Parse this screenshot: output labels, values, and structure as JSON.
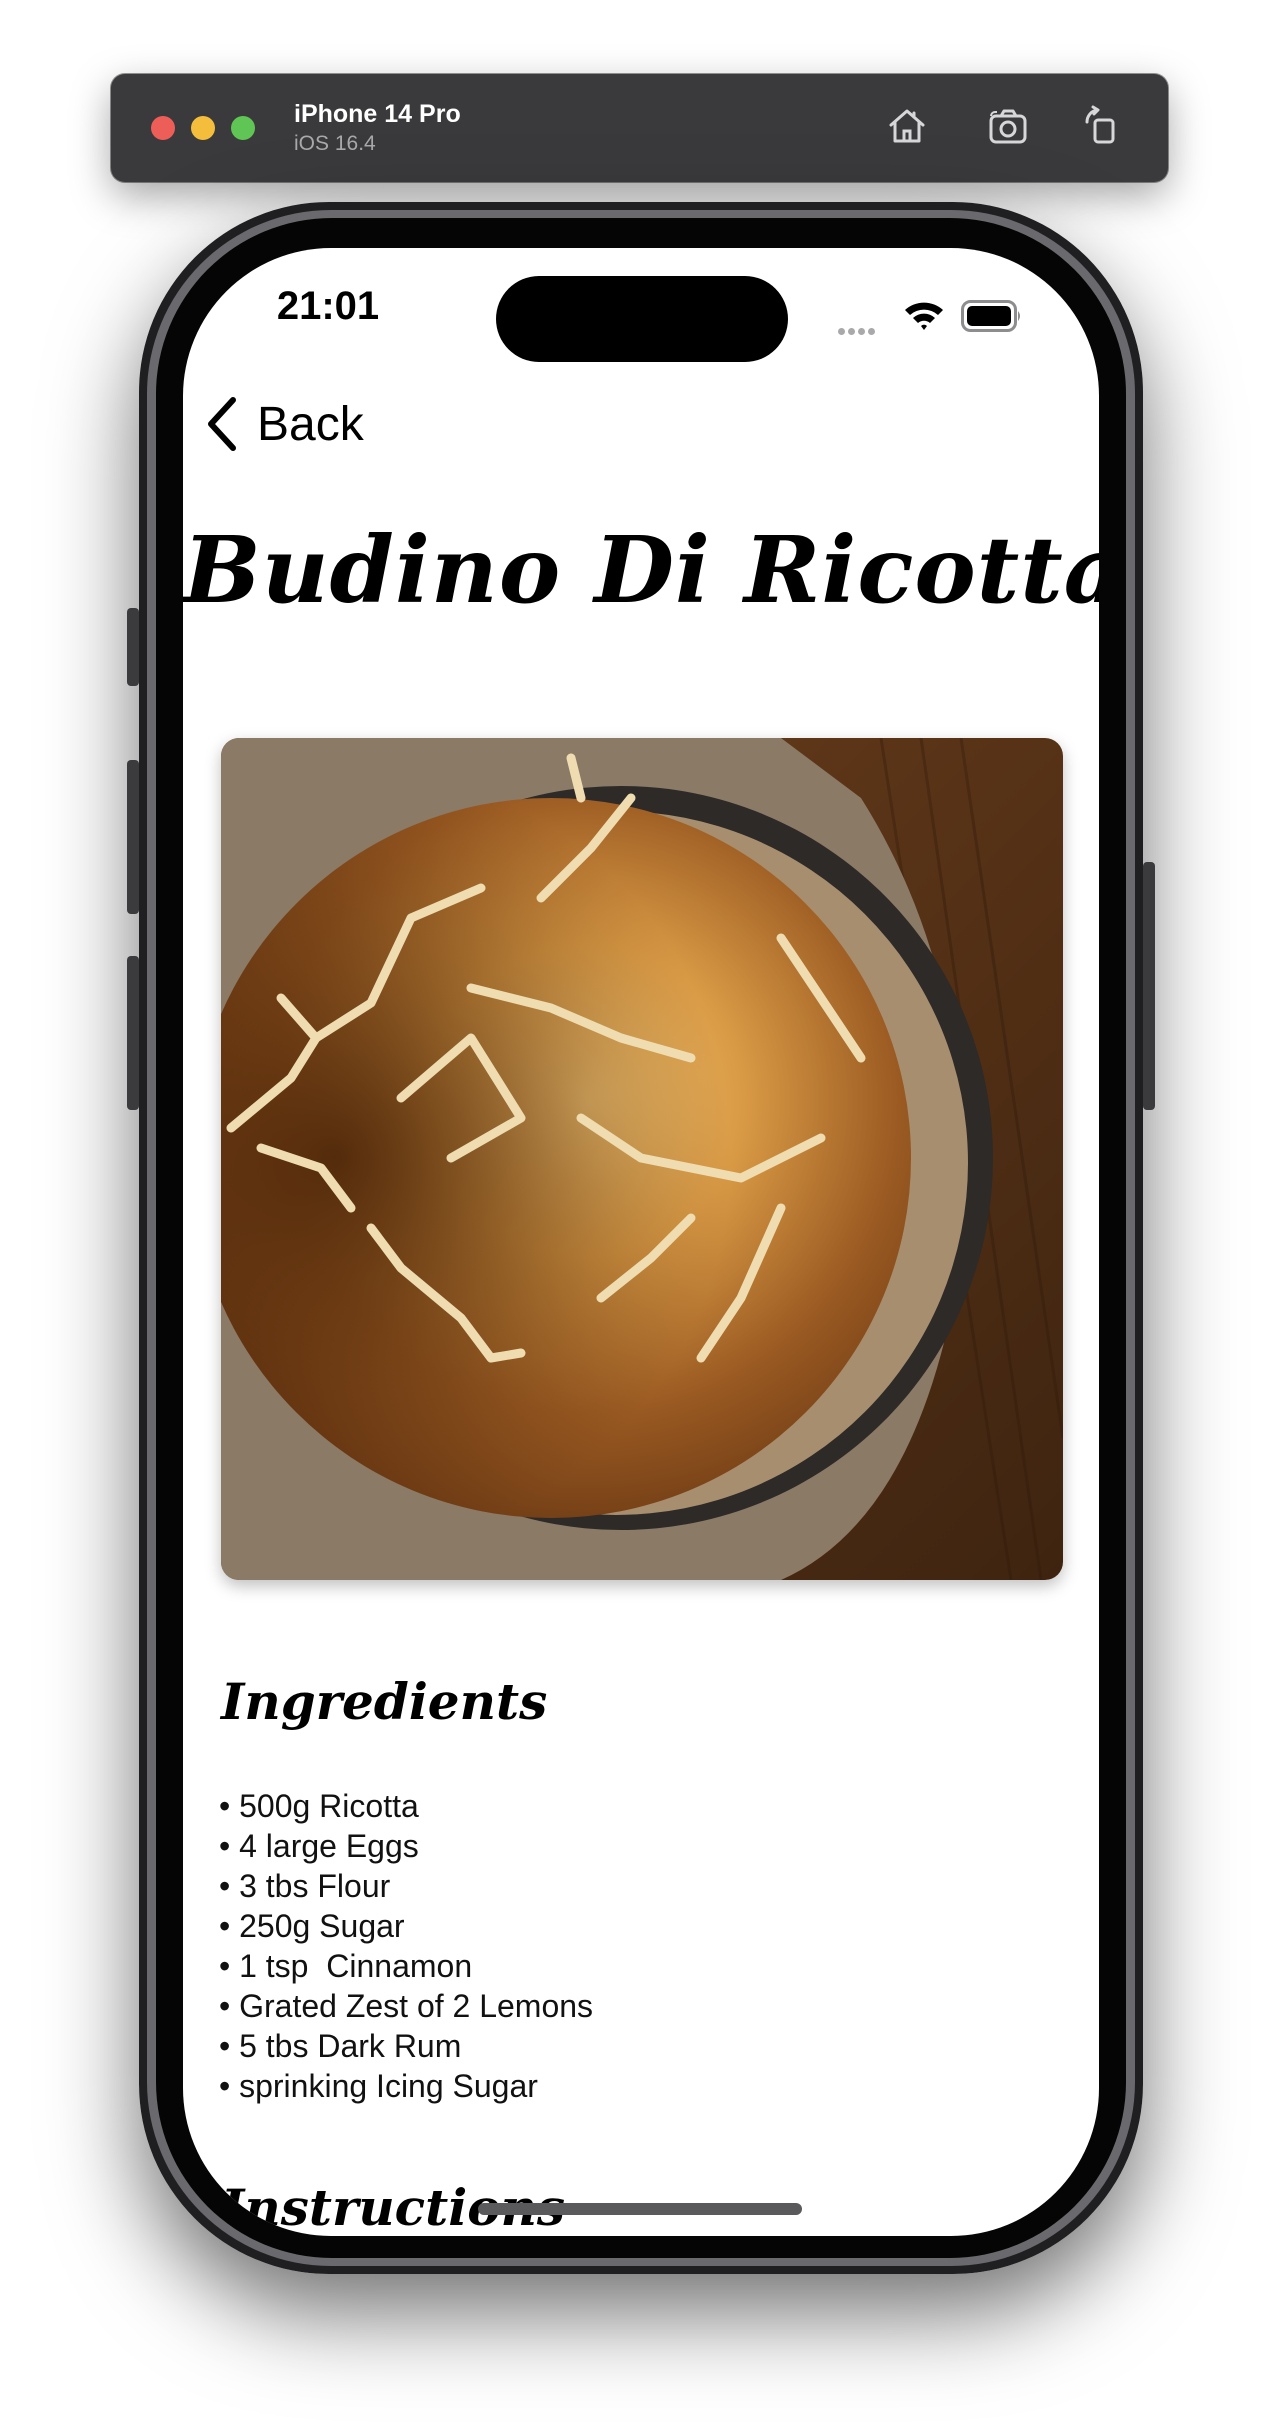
{
  "simulator": {
    "device_name": "iPhone 14 Pro",
    "os_version": "iOS 16.4",
    "toolbar_icons": [
      "home-icon",
      "screenshot-icon",
      "rotate-icon"
    ]
  },
  "status_bar": {
    "time": "21:01",
    "icons": [
      "signal-dots-icon",
      "wifi-icon",
      "battery-icon"
    ]
  },
  "nav": {
    "back_label": "Back"
  },
  "recipe": {
    "title": "Budino Di Ricotta",
    "ingredients_heading": "Ingredients",
    "ingredients": [
      "500g Ricotta",
      "4 large Eggs",
      "3 tbs Flour",
      "250g Sugar",
      "1 tsp  Cinnamon",
      "Grated Zest of 2 Lemons",
      "5 tbs Dark Rum",
      "sprinking Icing Sugar"
    ],
    "instructions_heading": "Instructions"
  },
  "colors": {
    "titlebar": "#3a393b",
    "close": "#ee5e58",
    "minimize": "#f4bd3c",
    "zoom": "#5fc554"
  }
}
